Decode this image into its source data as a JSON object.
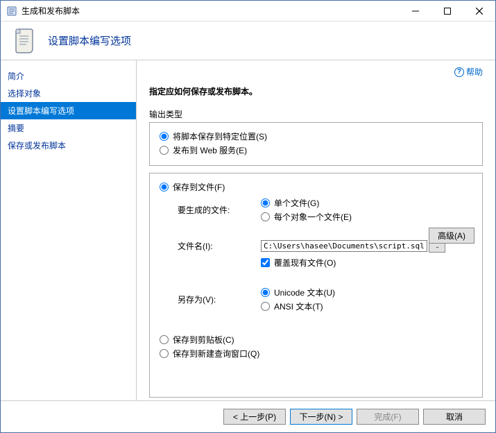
{
  "window": {
    "title": "生成和发布脚本"
  },
  "header": {
    "title": "设置脚本编写选项"
  },
  "help": {
    "label": "帮助"
  },
  "sidebar": {
    "items": [
      {
        "label": "简介"
      },
      {
        "label": "选择对象"
      },
      {
        "label": "设置脚本编写选项"
      },
      {
        "label": "摘要"
      },
      {
        "label": "保存或发布脚本"
      }
    ]
  },
  "main": {
    "instruction": "指定应如何保存或发布脚本。",
    "output_type_label": "输出类型",
    "opt_save_to_location": "将脚本保存到特定位置(S)",
    "opt_publish_web": "发布到 Web 服务(E)",
    "opt_save_to_file": "保存到文件(F)",
    "advanced_btn": "高级(A)",
    "files_to_generate_label": "要生成的文件:",
    "opt_single_file": "单个文件(G)",
    "opt_file_per_object": "每个对象一个文件(E)",
    "filename_label": "文件名(I):",
    "filename_value": "C:\\Users\\hasee\\Documents\\script.sql",
    "browse_btn": "..",
    "overwrite_label": "覆盖现有文件(O)",
    "save_as_label": "另存为(V):",
    "opt_unicode": "Unicode 文本(U)",
    "opt_ansi": "ANSI 文本(T)",
    "opt_save_clipboard": "保存到剪贴板(C)",
    "opt_save_new_query": "保存到新建查询窗口(Q)"
  },
  "footer": {
    "prev": "< 上一步(P)",
    "next": "下一步(N) >",
    "finish": "完成(F)",
    "cancel": "取消"
  }
}
